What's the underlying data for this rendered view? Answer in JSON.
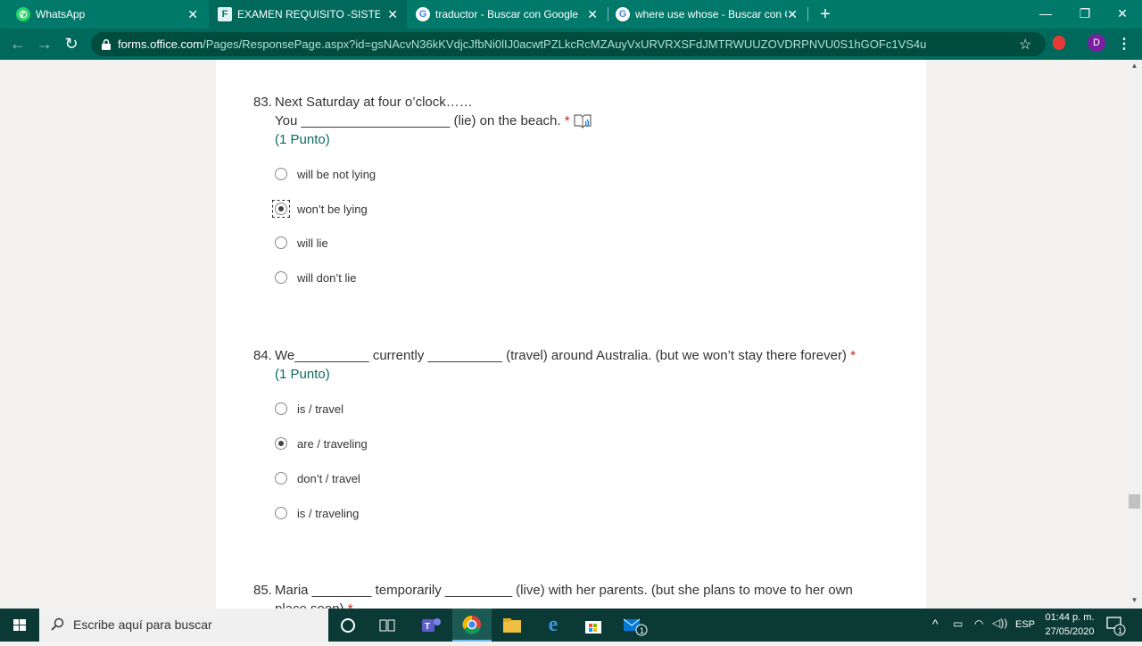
{
  "browser": {
    "tabs": [
      {
        "title": "WhatsApp",
        "icon": "whatsapp-icon",
        "active": false
      },
      {
        "title": "EXAMEN REQUISITO -SISTEMAS",
        "icon": "forms-icon",
        "active": true
      },
      {
        "title": "traductor - Buscar con Google",
        "icon": "google-icon",
        "active": false
      },
      {
        "title": "where use whose - Buscar con Go",
        "icon": "google-icon",
        "active": false
      }
    ],
    "new_tab": "+",
    "url_host": "forms.office.com",
    "url_path": "/Pages/ResponsePage.aspx?id=gsNAcvN36kKVdjcJfbNi0lIJ0acwtPZLkcRcMZAuyVxURVRXSFdJMTRWUUZOVDRPNVU0S1hGOFc1VS4u",
    "profile_initial": "D"
  },
  "form": {
    "questions": [
      {
        "number": "83.",
        "lines": [
          "Next Saturday at four o’clock……",
          "You ____________________ (lie) on the beach."
        ],
        "required": "*",
        "points": "(1 Punto)",
        "options": [
          "will be not lying",
          "won’t be lying",
          "will lie",
          "will don’t lie"
        ],
        "selected": 1
      },
      {
        "number": "84.",
        "lines": [
          "We__________ currently __________ (travel) around Australia. (but we won’t stay there forever)"
        ],
        "required": "*",
        "points": "(1 Punto)",
        "options": [
          "is / travel",
          "are / traveling",
          "don’t / travel",
          "is / traveling"
        ],
        "selected": 1
      },
      {
        "number": "85.",
        "lines": [
          "Maria ________ temporarily _________ (live) with her parents. (but she plans to move to her own",
          "place soon)"
        ],
        "required": "*"
      }
    ]
  },
  "taskbar": {
    "search_placeholder": "Escribe aquí para buscar",
    "language": "ESP",
    "time": "01:44 p. m.",
    "date": "27/05/2020",
    "mail_badge": "1",
    "notification_badge": "1"
  }
}
